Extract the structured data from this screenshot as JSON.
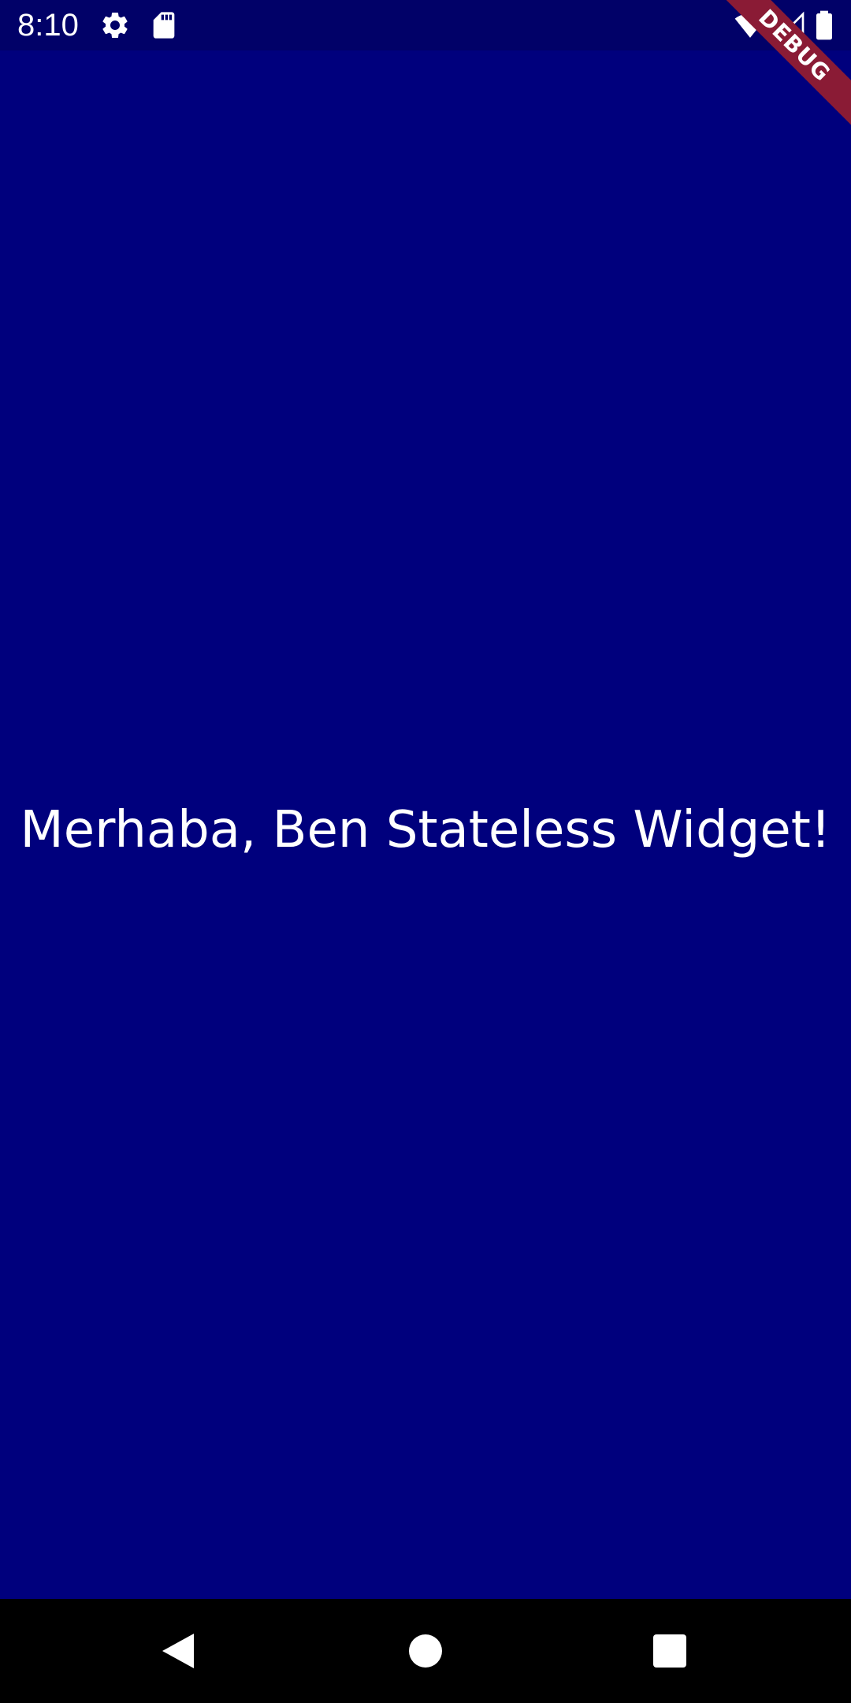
{
  "status_bar": {
    "time": "8:10",
    "icons": [
      "gear-icon",
      "sd-card-icon",
      "wifi-icon",
      "signal-icon",
      "battery-icon"
    ]
  },
  "debug_banner": {
    "label": "DEBUG",
    "color": "#8a1b35"
  },
  "main": {
    "text": "Merhaba, Ben Stateless Widget!",
    "background_color": "#00007d",
    "text_color": "#ffffff"
  },
  "nav_bar": {
    "buttons": [
      "back-icon",
      "home-icon",
      "recents-icon"
    ]
  }
}
